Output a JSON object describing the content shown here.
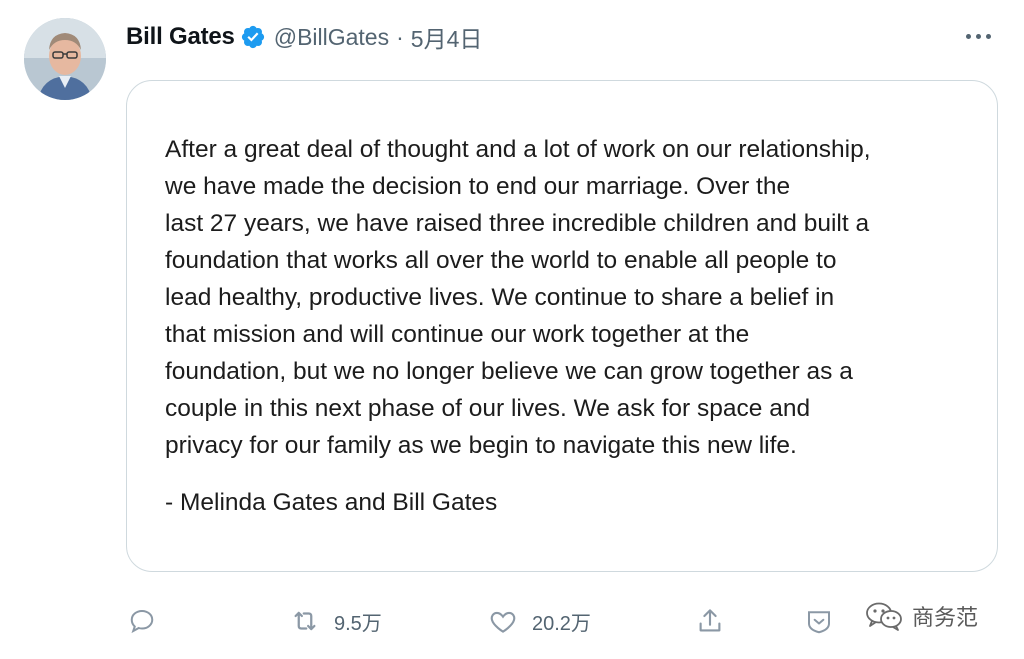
{
  "author": {
    "display_name": "Bill Gates",
    "handle": "@BillGates",
    "separator": "·",
    "date": "5月4日",
    "verified": true,
    "verified_color": "#1d9bf0"
  },
  "statement": {
    "lines": [
      "After a great deal of thought and a lot of work on our relationship,",
      "we have made the decision to end our marriage. Over the",
      "last 27 years, we have raised three incredible children and built a",
      "foundation that works all over the world to enable all people to",
      "lead healthy, productive lives. We continue to share a belief in",
      "that mission and will continue our work together at the",
      "foundation, but we no longer believe we can grow together as a",
      "couple in this next phase of our lives. We ask for space and",
      "privacy for our family as we begin to navigate this new life."
    ],
    "signature": "- Melinda Gates and Bill Gates"
  },
  "actions": {
    "reply": {
      "icon": "reply-icon"
    },
    "retweet": {
      "icon": "retweet-icon",
      "count": "9.5万"
    },
    "like": {
      "icon": "heart-icon",
      "count": "20.2万"
    },
    "share": {
      "icon": "share-icon"
    },
    "reveal": {
      "icon": "reveal-icon"
    }
  },
  "watermark": {
    "text": "商务范",
    "icon": "wechat-icon"
  },
  "colors": {
    "text_primary": "#0f1419",
    "text_secondary": "#536471",
    "border": "#cfd9de"
  }
}
